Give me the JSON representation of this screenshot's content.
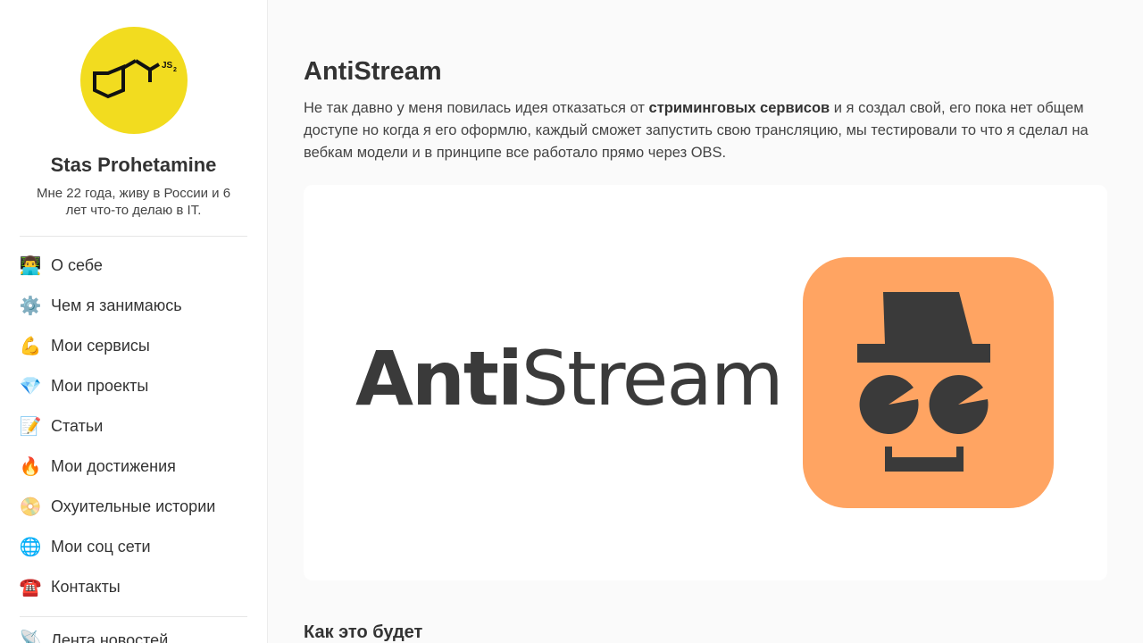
{
  "profile": {
    "avatar_text": "JS",
    "avatar_sub": "2",
    "name": "Stas Prohetamine",
    "bio": "Мне 22 года, живу в России и 6 лет что-то делаю в IT."
  },
  "nav": {
    "items": [
      {
        "icon": "👨‍💻",
        "icon_name": "technologist-icon",
        "label": "О себе"
      },
      {
        "icon": "⚙️",
        "icon_name": "gear-icon",
        "label": "Чем я занимаюсь"
      },
      {
        "icon": "💪",
        "icon_name": "flexed-biceps-icon",
        "label": "Мои сервисы"
      },
      {
        "icon": "💎",
        "icon_name": "gem-icon",
        "label": "Мои проекты"
      },
      {
        "icon": "📝",
        "icon_name": "memo-icon",
        "label": "Статьи"
      },
      {
        "icon": "🔥",
        "icon_name": "fire-icon",
        "label": "Мои достижения"
      },
      {
        "icon": "📀",
        "icon_name": "dvd-icon",
        "label": "Охуительные истории"
      },
      {
        "icon": "🌐",
        "icon_name": "globe-icon",
        "label": "Мои соц сети"
      },
      {
        "icon": "☎️",
        "icon_name": "telephone-icon",
        "label": "Контакты"
      }
    ],
    "extra": {
      "icon": "📡",
      "icon_name": "satellite-antenna-icon",
      "label": "Лента новостей"
    }
  },
  "post": {
    "title": "AntiStream",
    "intro_before": "Не так давно у меня повилась идея отказаться от ",
    "intro_bold": "стриминговых сервисов",
    "intro_after": " и я создал свой, его пока нет общем доступе но когда я его оформлю, каждый сможет запустить свою трансляцию, мы тестировали то что я сделал на вебкам модели и в принципе все работало прямо через OBS.",
    "banner_word_bold": "Anti",
    "banner_word_regular": "Stream",
    "section_title": "Как это будет"
  },
  "colors": {
    "avatar_bg": "#f2dc1f",
    "logo_bg": "#ffa462",
    "logo_fg": "#3a3a3a"
  }
}
